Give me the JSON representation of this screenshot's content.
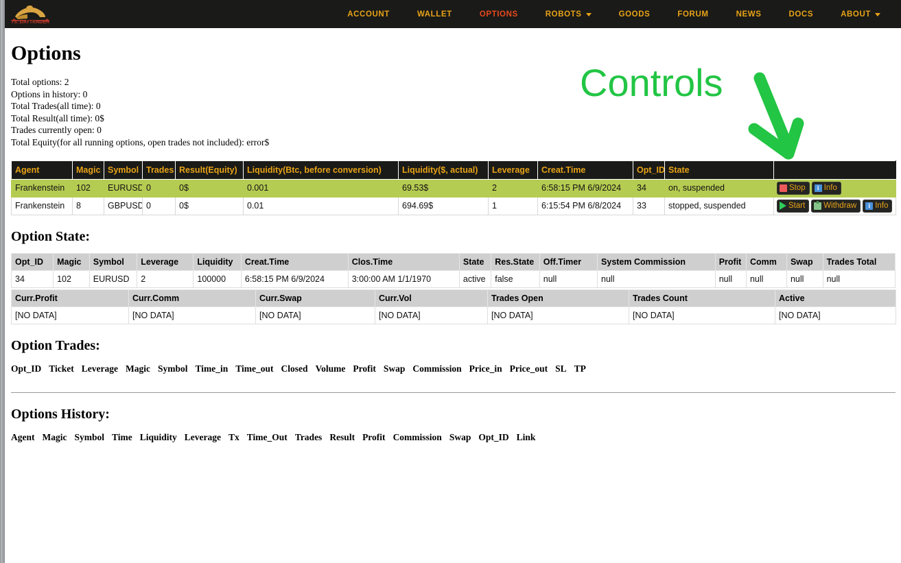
{
  "navbar": {
    "logo_text": "TS_DAYTRADER",
    "links": [
      {
        "label": "ACCOUNT",
        "active": false,
        "caret": false
      },
      {
        "label": "WALLET",
        "active": false,
        "caret": false
      },
      {
        "label": "OPTIONS",
        "active": true,
        "caret": false
      },
      {
        "label": "ROBOTS",
        "active": false,
        "caret": true
      },
      {
        "label": "GOODS",
        "active": false,
        "caret": false
      },
      {
        "label": "FORUM",
        "active": false,
        "caret": false
      },
      {
        "label": "NEWS",
        "active": false,
        "caret": false
      },
      {
        "label": "DOCS",
        "active": false,
        "caret": false
      },
      {
        "label": "ABOUT",
        "active": false,
        "caret": true
      }
    ]
  },
  "page": {
    "title": "Options",
    "stats": [
      "Total options: 2",
      "Options in history: 0",
      "Total Trades(all time): 0",
      "Total Result(all time): 0$",
      "Trades currently open: 0",
      "Total Equity(for all running options, open trades not included): error$"
    ]
  },
  "annotation": {
    "label": "Controls",
    "color": "#22c544"
  },
  "options_table": {
    "headers": [
      "Agent",
      "Magic",
      "Symbol",
      "Trades",
      "Result(Equity)",
      "Liquidity(Btc, before conversion)",
      "Liquidity($, actual)",
      "Leverage",
      "Creat.Time",
      "Opt_ID",
      "State",
      ""
    ],
    "rows": [
      {
        "highlighted": true,
        "cells": [
          "Frankenstein",
          "102",
          "EURUSD",
          "0",
          "0$",
          "0.001",
          "69.53$",
          "2",
          "6:58:15 PM 6/9/2024",
          "34",
          "on, suspended"
        ],
        "actions": [
          {
            "label": "Stop",
            "icon": "stop-square-icon"
          },
          {
            "label": "Info",
            "icon": "info-icon"
          }
        ]
      },
      {
        "highlighted": false,
        "cells": [
          "Frankenstein",
          "8",
          "GBPUSD",
          "0",
          "0$",
          "0.01",
          "694.69$",
          "1",
          "6:15:54 PM 6/8/2024",
          "33",
          "stopped, suspended"
        ],
        "actions": [
          {
            "label": "Start",
            "icon": "play-icon"
          },
          {
            "label": "Withdraw",
            "icon": "withdraw-icon"
          },
          {
            "label": "Info",
            "icon": "info-icon"
          }
        ]
      }
    ]
  },
  "option_state": {
    "title": "Option State:",
    "row1_headers": [
      "Opt_ID",
      "Magic",
      "Symbol",
      "Leverage",
      "Liquidity",
      "Creat.Time",
      "Clos.Time",
      "State",
      "Res.State",
      "Off.Timer",
      "System Commission",
      "Profit",
      "Comm",
      "Swap",
      "Trades Total"
    ],
    "row1_values": [
      "34",
      "102",
      "EURUSD",
      "2",
      "100000",
      "6:58:15 PM 6/9/2024",
      "3:00:00 AM 1/1/1970",
      "active",
      "false",
      "null",
      "null",
      "null",
      "null",
      "null",
      "null"
    ],
    "row2_headers": [
      "Curr.Profit",
      "Curr.Comm",
      "Curr.Swap",
      "Curr.Vol",
      "Trades Open",
      "Trades Count",
      "Active"
    ],
    "row2_values": [
      "[NO DATA]",
      "[NO DATA]",
      "[NO DATA]",
      "[NO DATA]",
      "[NO DATA]",
      "[NO DATA]",
      "[NO DATA]"
    ]
  },
  "option_trades": {
    "title": "Option Trades:",
    "headers": [
      "Opt_ID",
      "Ticket",
      "Leverage",
      "Magic",
      "Symbol",
      "Time_in",
      "Time_out",
      "Closed",
      "Volume",
      "Profit",
      "Swap",
      "Commission",
      "Price_in",
      "Price_out",
      "SL",
      "TP"
    ]
  },
  "options_history": {
    "title": "Options History:",
    "headers": [
      "Agent",
      "Magic",
      "Symbol",
      "Time",
      "Liquidity",
      "Leverage",
      "Tx",
      "Time_Out",
      "Trades",
      "Result",
      "Profit",
      "Commission",
      "Swap",
      "Opt_ID",
      "Link"
    ]
  }
}
